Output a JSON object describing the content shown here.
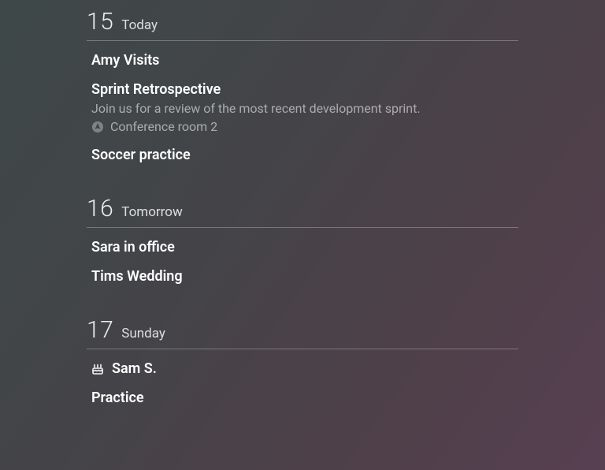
{
  "days": [
    {
      "number": "15",
      "label": "Today",
      "events": [
        {
          "title": "Amy Visits"
        },
        {
          "title": "Sprint Retrospective",
          "description": "Join us for a review of the most recent development sprint.",
          "location": "Conference room 2"
        },
        {
          "title": "Soccer practice"
        }
      ]
    },
    {
      "number": "16",
      "label": "Tomorrow",
      "events": [
        {
          "title": "Sara in office"
        },
        {
          "title": "Tims Wedding"
        }
      ]
    },
    {
      "number": "17",
      "label": "Sunday",
      "events": [
        {
          "title": "Sam S.",
          "icon": "birthday"
        },
        {
          "title": "Practice"
        }
      ]
    }
  ]
}
